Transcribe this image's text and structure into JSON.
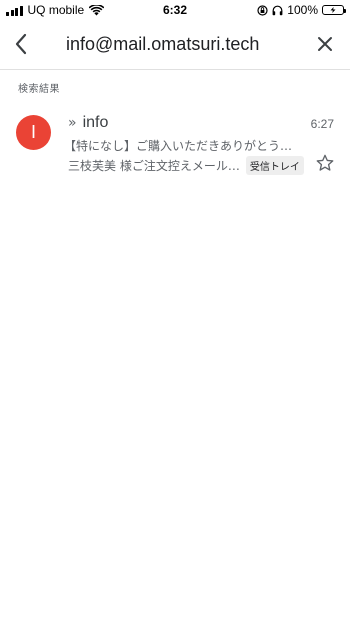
{
  "status_bar": {
    "carrier": "UQ mobile",
    "time": "6:32",
    "battery_percent": "100%",
    "battery_level": 1.0,
    "icons": [
      "signal-icon",
      "wifi-icon",
      "orientation-lock-icon",
      "headphones-icon",
      "battery-charging-icon"
    ]
  },
  "header": {
    "query": "info@mail.omatsuri.tech",
    "back_icon": "back-arrow-icon",
    "clear_icon": "close-icon"
  },
  "results": {
    "section_label": "検索結果",
    "emails": [
      {
        "avatar_letter": "I",
        "avatar_color": "#ea4335",
        "importance_marker": "»",
        "sender": "info",
        "time": "6:27",
        "subject": "【特になし】ご購入いただきありがとう…",
        "snippet": "三枝芙美 様ご注文控えメール…",
        "label": "受信トレイ",
        "starred": false
      }
    ]
  },
  "colors": {
    "accent_red": "#ea4335",
    "battery_green": "#4cd964",
    "text_primary": "#202124",
    "text_secondary": "#5f6368"
  }
}
